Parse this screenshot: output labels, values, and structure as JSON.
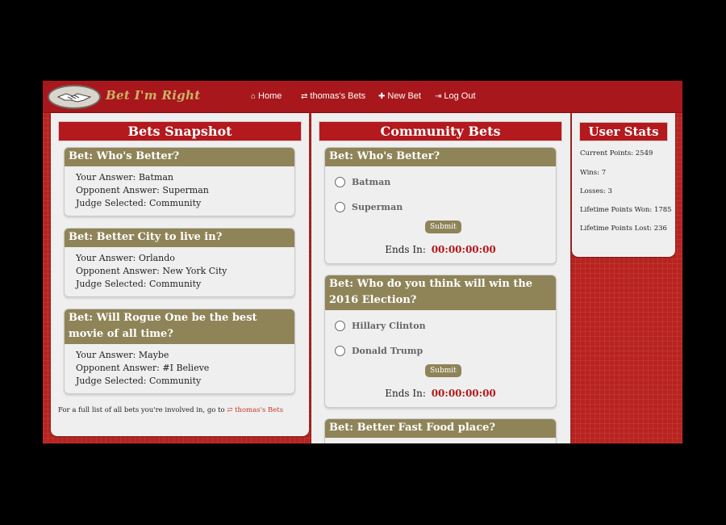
{
  "brand": {
    "name": "Bet I'm Right"
  },
  "nav": [
    {
      "icon": "home-icon",
      "glyph": "⌂",
      "label": "Home"
    },
    {
      "icon": "swap-icon",
      "glyph": "⇄",
      "label": "thomas's Bets"
    },
    {
      "icon": "plus-icon",
      "glyph": "✚",
      "label": "New Bet"
    },
    {
      "icon": "logout-icon",
      "glyph": "⇥",
      "label": "Log Out"
    }
  ],
  "snapshot": {
    "title": "Bets Snapshot",
    "bets": [
      {
        "title": "Bet: Who's Better?",
        "your": "Your Answer: Batman",
        "opponent": "Opponent Answer: Superman",
        "judge": "Judge Selected: Community"
      },
      {
        "title": "Bet: Better City to live in?",
        "your": "Your Answer: Orlando",
        "opponent": "Opponent Answer: New York City",
        "judge": "Judge Selected: Community"
      },
      {
        "title": "Bet: Will Rogue One be the best movie of all time?",
        "your": "Your Answer: Maybe",
        "opponent": "Opponent Answer: #I Believe",
        "judge": "Judge Selected: Community"
      }
    ],
    "footnote": "For a full list of all bets you're involved in, go to",
    "footnote_link": "⇄ thomas's Bets"
  },
  "community": {
    "title": "Community Bets",
    "bets": [
      {
        "title": "Bet: Who's Better?",
        "options": [
          "Batman",
          "Superman"
        ],
        "submit": "Submit",
        "ends_label": "Ends In:",
        "ends_value": "00:00:00:00"
      },
      {
        "title": "Bet: Who do you think will win the 2016 Election?",
        "options": [
          "Hillary Clinton",
          "Donald Trump"
        ],
        "submit": "Submit",
        "ends_label": "Ends In:",
        "ends_value": "00:00:00:00"
      },
      {
        "title": "Bet: Better Fast Food place?"
      }
    ]
  },
  "stats": {
    "title": "User Stats",
    "items": [
      "Current Points: 2549",
      "Wins: 7",
      "Losses: 3",
      "Lifetime Points Won: 1785",
      "Lifetime Points Lost: 236"
    ]
  },
  "colors": {
    "brand_red": "#b3191d",
    "olive": "#8f8458",
    "timer_red": "#b3191d"
  }
}
